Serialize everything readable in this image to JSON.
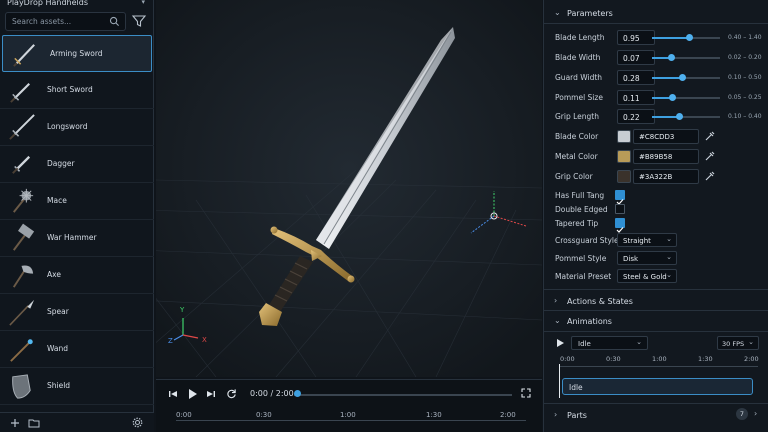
{
  "left": {
    "title": "PlayDrop Handhelds",
    "search_placeholder": "Search assets...",
    "items": [
      {
        "label": "Arming Sword"
      },
      {
        "label": "Short Sword"
      },
      {
        "label": "Longsword"
      },
      {
        "label": "Dagger"
      },
      {
        "label": "Mace"
      },
      {
        "label": "War Hammer"
      },
      {
        "label": "Axe"
      },
      {
        "label": "Spear"
      },
      {
        "label": "Wand"
      },
      {
        "label": "Shield"
      }
    ]
  },
  "viewport": {
    "axis_x": "X",
    "axis_y": "Y",
    "axis_z": "Z"
  },
  "timeline": {
    "time": "0:00 / 2:00",
    "progress": 0.0,
    "ruler": [
      "0:00",
      "0:30",
      "1:00",
      "1:30",
      "2:00"
    ]
  },
  "params": {
    "title": "Parameters",
    "sliders": [
      {
        "label": "Blade Length",
        "value": "0.95",
        "min": "0.40",
        "max": "1.40",
        "sep": "–",
        "level": 0.55
      },
      {
        "label": "Blade Width",
        "value": "0.07",
        "min": "0.02",
        "max": "0.20",
        "sep": "–",
        "level": 0.28
      },
      {
        "label": "Guard Width",
        "value": "0.28",
        "min": "0.10",
        "max": "0.50",
        "sep": "–",
        "level": 0.45
      },
      {
        "label": "Pommel Size",
        "value": "0.11",
        "min": "0.05",
        "max": "0.25",
        "sep": "–",
        "level": 0.3
      },
      {
        "label": "Grip Length",
        "value": "0.22",
        "min": "0.10",
        "max": "0.40",
        "sep": "–",
        "level": 0.4
      }
    ],
    "colors": [
      {
        "label": "Blade Color",
        "hex": "#C8CDD3"
      },
      {
        "label": "Metal Color",
        "hex": "#B89B58"
      },
      {
        "label": "Grip Color",
        "hex": "#3A322B"
      }
    ],
    "checks": [
      {
        "label": "Has Full Tang",
        "checked": true
      },
      {
        "label": "Double Edged",
        "checked": false
      },
      {
        "label": "Tapered Tip",
        "checked": true
      }
    ],
    "selects": [
      {
        "label": "Crossguard Style",
        "value": "Straight"
      },
      {
        "label": "Pommel Style",
        "value": "Disk"
      },
      {
        "label": "Material Preset",
        "value": "Steel & Gold"
      }
    ]
  },
  "sections": {
    "actions": "Actions & States",
    "animations": "Animations",
    "anim_clip": "Idle",
    "fps": "30 FPS",
    "anim_ruler": [
      "0:00",
      "0:30",
      "1:00",
      "1:30",
      "2:00"
    ],
    "clip_label": "Idle",
    "parts": "Parts",
    "parts_count": "7"
  },
  "colors": {
    "accent": "#3ea0e0",
    "panel": "#12181f",
    "viewport": "#161c22"
  }
}
